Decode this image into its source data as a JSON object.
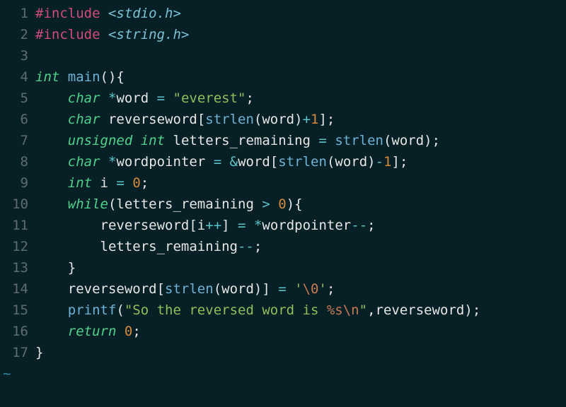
{
  "editor": {
    "tilde": "~",
    "lines": [
      {
        "num": "1",
        "tokens": [
          {
            "cls": "tok-pp",
            "t": "#include "
          },
          {
            "cls": "tok-inc",
            "t": "<stdio.h>"
          }
        ]
      },
      {
        "num": "2",
        "tokens": [
          {
            "cls": "tok-pp",
            "t": "#include "
          },
          {
            "cls": "tok-inc",
            "t": "<string.h>"
          }
        ]
      },
      {
        "num": "3",
        "tokens": []
      },
      {
        "num": "4",
        "tokens": [
          {
            "cls": "tok-kw",
            "t": "int"
          },
          {
            "cls": "tok-id",
            "t": " "
          },
          {
            "cls": "tok-fn",
            "t": "main"
          },
          {
            "cls": "tok-pn",
            "t": "(){"
          }
        ]
      },
      {
        "num": "5",
        "tokens": [
          {
            "cls": "tok-id",
            "t": "    "
          },
          {
            "cls": "tok-kw",
            "t": "char"
          },
          {
            "cls": "tok-id",
            "t": " "
          },
          {
            "cls": "tok-op",
            "t": "*"
          },
          {
            "cls": "tok-id",
            "t": "word "
          },
          {
            "cls": "tok-op",
            "t": "="
          },
          {
            "cls": "tok-id",
            "t": " "
          },
          {
            "cls": "tok-str",
            "t": "\"everest\""
          },
          {
            "cls": "tok-pn",
            "t": ";"
          }
        ]
      },
      {
        "num": "6",
        "tokens": [
          {
            "cls": "tok-id",
            "t": "    "
          },
          {
            "cls": "tok-kw",
            "t": "char"
          },
          {
            "cls": "tok-id",
            "t": " reverseword"
          },
          {
            "cls": "tok-pn",
            "t": "["
          },
          {
            "cls": "tok-fn",
            "t": "strlen"
          },
          {
            "cls": "tok-pn",
            "t": "("
          },
          {
            "cls": "tok-id",
            "t": "word"
          },
          {
            "cls": "tok-pn",
            "t": ")"
          },
          {
            "cls": "tok-op",
            "t": "+"
          },
          {
            "cls": "tok-num",
            "t": "1"
          },
          {
            "cls": "tok-pn",
            "t": "];"
          }
        ]
      },
      {
        "num": "7",
        "tokens": [
          {
            "cls": "tok-id",
            "t": "    "
          },
          {
            "cls": "tok-kw",
            "t": "unsigned"
          },
          {
            "cls": "tok-id",
            "t": " "
          },
          {
            "cls": "tok-kw",
            "t": "int"
          },
          {
            "cls": "tok-id",
            "t": " letters_remaining "
          },
          {
            "cls": "tok-op",
            "t": "="
          },
          {
            "cls": "tok-id",
            "t": " "
          },
          {
            "cls": "tok-fn",
            "t": "strlen"
          },
          {
            "cls": "tok-pn",
            "t": "("
          },
          {
            "cls": "tok-id",
            "t": "word"
          },
          {
            "cls": "tok-pn",
            "t": ");"
          }
        ]
      },
      {
        "num": "8",
        "tokens": [
          {
            "cls": "tok-id",
            "t": "    "
          },
          {
            "cls": "tok-kw",
            "t": "char"
          },
          {
            "cls": "tok-id",
            "t": " "
          },
          {
            "cls": "tok-op",
            "t": "*"
          },
          {
            "cls": "tok-id",
            "t": "wordpointer "
          },
          {
            "cls": "tok-op",
            "t": "="
          },
          {
            "cls": "tok-id",
            "t": " "
          },
          {
            "cls": "tok-op",
            "t": "&"
          },
          {
            "cls": "tok-id",
            "t": "word"
          },
          {
            "cls": "tok-pn",
            "t": "["
          },
          {
            "cls": "tok-fn",
            "t": "strlen"
          },
          {
            "cls": "tok-pn",
            "t": "("
          },
          {
            "cls": "tok-id",
            "t": "word"
          },
          {
            "cls": "tok-pn",
            "t": ")"
          },
          {
            "cls": "tok-op",
            "t": "-"
          },
          {
            "cls": "tok-num",
            "t": "1"
          },
          {
            "cls": "tok-pn",
            "t": "];"
          }
        ]
      },
      {
        "num": "9",
        "tokens": [
          {
            "cls": "tok-id",
            "t": "    "
          },
          {
            "cls": "tok-kw",
            "t": "int"
          },
          {
            "cls": "tok-id",
            "t": " i "
          },
          {
            "cls": "tok-op",
            "t": "="
          },
          {
            "cls": "tok-id",
            "t": " "
          },
          {
            "cls": "tok-num",
            "t": "0"
          },
          {
            "cls": "tok-pn",
            "t": ";"
          }
        ]
      },
      {
        "num": "10",
        "tokens": [
          {
            "cls": "tok-id",
            "t": "    "
          },
          {
            "cls": "tok-kw",
            "t": "while"
          },
          {
            "cls": "tok-pn",
            "t": "("
          },
          {
            "cls": "tok-id",
            "t": "letters_remaining "
          },
          {
            "cls": "tok-op",
            "t": ">"
          },
          {
            "cls": "tok-id",
            "t": " "
          },
          {
            "cls": "tok-num",
            "t": "0"
          },
          {
            "cls": "tok-pn",
            "t": "){"
          }
        ]
      },
      {
        "num": "11",
        "tokens": [
          {
            "cls": "tok-id",
            "t": "        reverseword"
          },
          {
            "cls": "tok-pn",
            "t": "["
          },
          {
            "cls": "tok-id",
            "t": "i"
          },
          {
            "cls": "tok-op",
            "t": "++"
          },
          {
            "cls": "tok-pn",
            "t": "]"
          },
          {
            "cls": "tok-id",
            "t": " "
          },
          {
            "cls": "tok-op",
            "t": "="
          },
          {
            "cls": "tok-id",
            "t": " "
          },
          {
            "cls": "tok-op",
            "t": "*"
          },
          {
            "cls": "tok-id",
            "t": "wordpointer"
          },
          {
            "cls": "tok-op",
            "t": "--"
          },
          {
            "cls": "tok-pn",
            "t": ";"
          }
        ]
      },
      {
        "num": "12",
        "tokens": [
          {
            "cls": "tok-id",
            "t": "        letters_remaining"
          },
          {
            "cls": "tok-op",
            "t": "--"
          },
          {
            "cls": "tok-pn",
            "t": ";"
          }
        ]
      },
      {
        "num": "13",
        "tokens": [
          {
            "cls": "tok-id",
            "t": "    "
          },
          {
            "cls": "tok-pn",
            "t": "}"
          }
        ]
      },
      {
        "num": "14",
        "tokens": [
          {
            "cls": "tok-id",
            "t": "    reverseword"
          },
          {
            "cls": "tok-pn",
            "t": "["
          },
          {
            "cls": "tok-fn",
            "t": "strlen"
          },
          {
            "cls": "tok-pn",
            "t": "("
          },
          {
            "cls": "tok-id",
            "t": "word"
          },
          {
            "cls": "tok-pn",
            "t": ")] "
          },
          {
            "cls": "tok-op",
            "t": "="
          },
          {
            "cls": "tok-id",
            "t": " "
          },
          {
            "cls": "tok-str",
            "t": "'"
          },
          {
            "cls": "tok-esc",
            "t": "\\0"
          },
          {
            "cls": "tok-str",
            "t": "'"
          },
          {
            "cls": "tok-pn",
            "t": ";"
          }
        ]
      },
      {
        "num": "15",
        "tokens": [
          {
            "cls": "tok-id",
            "t": "    "
          },
          {
            "cls": "tok-fn",
            "t": "printf"
          },
          {
            "cls": "tok-pn",
            "t": "("
          },
          {
            "cls": "tok-str",
            "t": "\"So the reversed word is "
          },
          {
            "cls": "tok-pct",
            "t": "%s"
          },
          {
            "cls": "tok-esc",
            "t": "\\n"
          },
          {
            "cls": "tok-str",
            "t": "\""
          },
          {
            "cls": "tok-pn",
            "t": ","
          },
          {
            "cls": "tok-id",
            "t": "reverseword"
          },
          {
            "cls": "tok-pn",
            "t": ");"
          }
        ]
      },
      {
        "num": "16",
        "tokens": [
          {
            "cls": "tok-id",
            "t": "    "
          },
          {
            "cls": "tok-kw",
            "t": "return"
          },
          {
            "cls": "tok-id",
            "t": " "
          },
          {
            "cls": "tok-num",
            "t": "0"
          },
          {
            "cls": "tok-pn",
            "t": ";"
          }
        ]
      },
      {
        "num": "17",
        "tokens": [
          {
            "cls": "tok-pn",
            "t": "}"
          }
        ]
      }
    ]
  }
}
